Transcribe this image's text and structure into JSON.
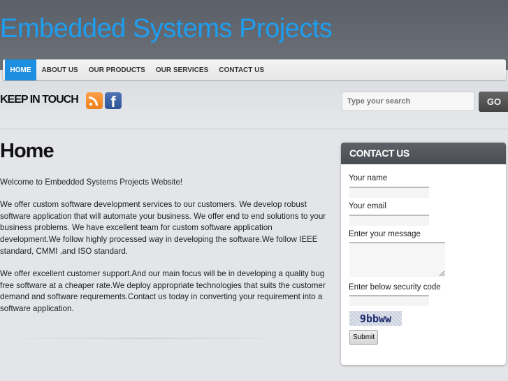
{
  "site_title": "Embedded Systems Projects",
  "nav": [
    {
      "label": "HOME",
      "active": true
    },
    {
      "label": "ABOUT US"
    },
    {
      "label": "OUR PRODUCTS"
    },
    {
      "label": "OUR SERVICES"
    },
    {
      "label": "CONTACT US"
    }
  ],
  "touch": {
    "heading": "KEEP IN TOUCH",
    "icons": [
      "rss-icon",
      "facebook-icon"
    ],
    "facebook_glyph": "f"
  },
  "search": {
    "placeholder": "Type your search",
    "button": "GO"
  },
  "main": {
    "title": "Home",
    "paragraphs": [
      "Welcome to Embedded Systems Projects Website!",
      "We offer custom software development services to our customers. We develop robust software application that will automate your business. We offer end to end solutions to your business problems. We have excellent team for custom software application development.We follow highly processed way in developing the software.We follow IEEE standard, CMMI ,and ISO standard.",
      "We offer excellent customer support.And our main focus will be in developing a quality bug free software at a cheaper rate.We deploy appropriate technologies that suits the customer demand and software requrements.Contact us today in converting your requirement into a software application."
    ]
  },
  "contact": {
    "title": "CONTACT US",
    "name_label": "Your name",
    "email_label": "Your email",
    "message_label": "Enter your message",
    "code_label": "Enter below security code",
    "captcha_text": "9bbww",
    "submit": "Submit"
  },
  "colors": {
    "accent": "#1e9ef0",
    "nav_active": "#1e8fe0",
    "header": "#5b5f67"
  }
}
